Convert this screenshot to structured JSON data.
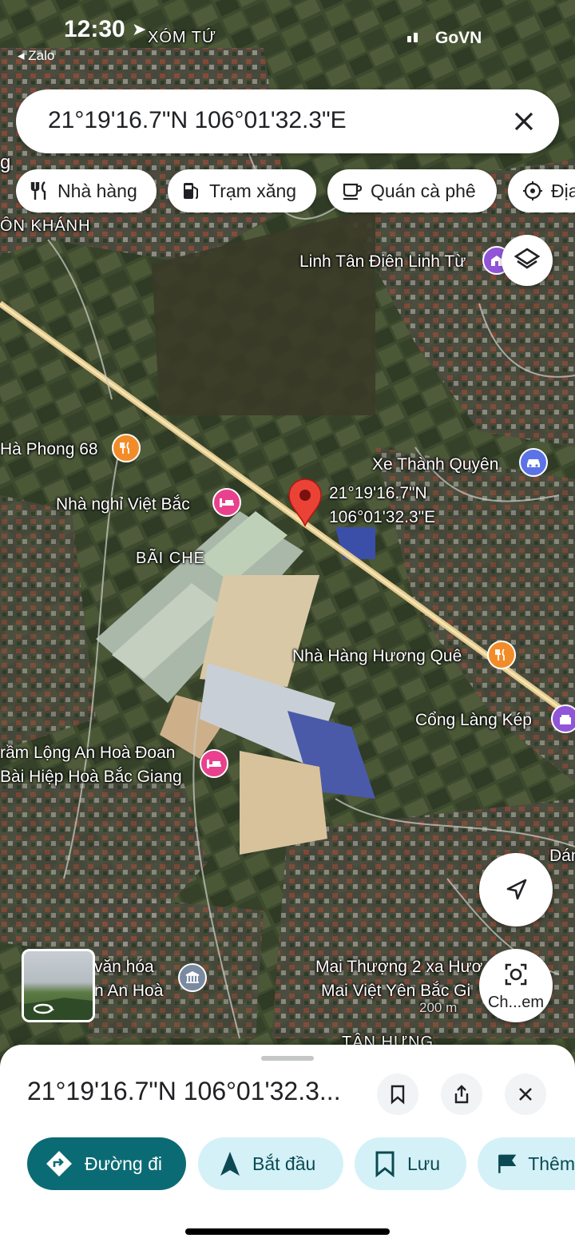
{
  "status_bar": {
    "time": "12:30",
    "back_app": "Zalo",
    "carrier": "GoVN"
  },
  "search": {
    "query": "21°19'16.7\"N 106°01'32.3\"E"
  },
  "chips": [
    {
      "label": "Nhà hàng",
      "icon": "restaurant-icon"
    },
    {
      "label": "Trạm xăng",
      "icon": "gas-station-icon"
    },
    {
      "label": "Quán cà phê",
      "icon": "coffee-icon"
    },
    {
      "label": "Địa",
      "icon": "attraction-icon"
    }
  ],
  "map_labels": {
    "xom_tu": "XÓM TỨ",
    "on_khanh": "ÔN KHÁNH",
    "bai_che": "BÃI CHE",
    "tan_hung": "TÂN HƯNG",
    "g_edge": "g",
    "dan_edge": "Dán"
  },
  "pois": {
    "linh_tu": "Linh Tân Điên Linh Từ",
    "ha_phong": "Hà Phong 68",
    "xe_thanh_quyen": "Xe Thành Quyên",
    "nha_nghi": "Nhà nghỉ Việt Bắc",
    "huong_que": "Nhà Hàng Hương Quê",
    "cong_lang": "Cổng Làng Kép",
    "tram_long_1": "rầm Lộng An Hoà Đoan",
    "tram_long_2": "Bài Hiệp Hoà Bắc Giang",
    "van_hoa_1": "văn hóa",
    "van_hoa_2": "n An Hoà",
    "mai_thuong_1": "Mai Thượng 2 xa Hươ",
    "mai_thuong_2": "Mai Việt Yên Bắc Gi"
  },
  "pin": {
    "lat": "21°19'16.7\"N",
    "lng": "106°01'32.3\"E"
  },
  "scale": "200 m",
  "fab_capture_label": "Ch...em",
  "sheet": {
    "title": "21°19'16.7\"N 106°01'32.3...",
    "actions": [
      {
        "label": "Đường đi",
        "icon": "directions-icon"
      },
      {
        "label": "Bắt đầu",
        "icon": "navigation-arrow-icon"
      },
      {
        "label": "Lưu",
        "icon": "bookmark-icon"
      },
      {
        "label": "Thêm",
        "icon": "flag-icon"
      }
    ]
  },
  "colors": {
    "primary_button": "#0b6b74",
    "secondary_button": "#d4f1f8",
    "pin": "#ea4335",
    "poi_food": "#f28c28",
    "poi_hotel": "#e9418d",
    "poi_attraction": "#9155d8",
    "poi_transport": "#5b73e6",
    "poi_civic": "#7a8aa0"
  }
}
